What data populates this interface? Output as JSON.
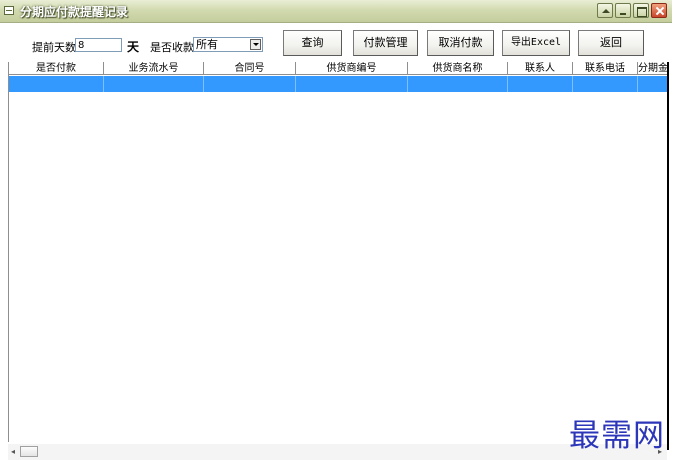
{
  "window": {
    "title": "分期应付款提醒记录",
    "buttons": [
      "restore",
      "minimize",
      "maximize",
      "close"
    ]
  },
  "toolbar": {
    "days_label": "提前天数",
    "days_value": "8",
    "days_unit": "天",
    "collected_label": "是否收款",
    "collected_value": "所有",
    "query_label": "查询",
    "payment_label": "付款管理",
    "cancel_label": "取消付款",
    "export_label": "导出Excel",
    "back_label": "返回"
  },
  "table": {
    "columns": [
      "是否付款",
      "业务流水号",
      "合同号",
      "供货商编号",
      "供货商名称",
      "联系人",
      "联系电话",
      "分期金额"
    ],
    "rows": [
      [
        "",
        "",
        "",
        "",
        "",
        "",
        "",
        ""
      ]
    ]
  },
  "watermark": "最需网",
  "colors": {
    "titlebar": "#c4cd9c",
    "selected_row": "#3399ff",
    "watermark": "#2c36b8"
  }
}
